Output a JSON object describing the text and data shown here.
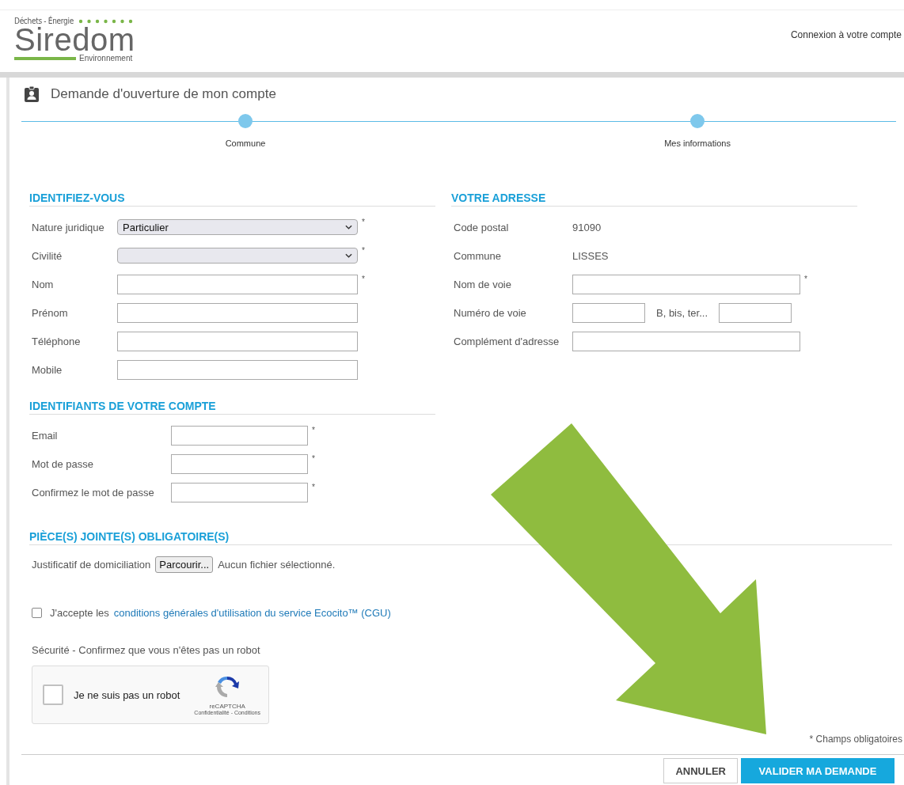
{
  "header": {
    "tagline": "Déchets - Énergie",
    "logo_name": "Siredom",
    "logo_subtitle": "Environnement",
    "login_link": "Connexion à votre compte"
  },
  "page_title": "Demande d'ouverture de mon compte",
  "steps": [
    {
      "label": "Commune"
    },
    {
      "label": "Mes informations"
    }
  ],
  "identity": {
    "title": "IDENTIFIEZ-VOUS",
    "fields": [
      {
        "kind": "select",
        "label": "Nature juridique",
        "value": "Particulier",
        "mark": "*"
      },
      {
        "kind": "select",
        "label": "Civilité",
        "mark": "*"
      },
      {
        "kind": "text",
        "label": "Nom",
        "mark": "*"
      },
      {
        "kind": "text",
        "label": "Prénom"
      },
      {
        "kind": "text",
        "label": "Téléphone"
      },
      {
        "kind": "text",
        "label": "Mobile"
      }
    ]
  },
  "address": {
    "title": "VOTRE ADRESSE",
    "fields": [
      {
        "kind": "static",
        "label": "Code postal",
        "value": "91090"
      },
      {
        "kind": "static",
        "label": "Commune",
        "value": "LISSES"
      },
      {
        "kind": "text",
        "label": "Nom de voie",
        "mark": "*"
      },
      {
        "kind": "pair",
        "label": "Numéro de voie",
        "second_label": "B, bis, ter..."
      },
      {
        "kind": "text",
        "label": "Complément d'adresse"
      }
    ]
  },
  "account": {
    "title": "IDENTIFIANTS DE VOTRE COMPTE",
    "fields": [
      {
        "kind": "text",
        "label": "Email",
        "mark": "*"
      },
      {
        "kind": "text",
        "label": "Mot de passe",
        "mark": "*"
      },
      {
        "kind": "text",
        "label": "Confirmez le mot de passe",
        "mark": "*"
      }
    ]
  },
  "attachments": {
    "title": "PIÈCE(S) JOINTE(S) OBLIGATOIRE(S)",
    "label": "Justificatif de domiciliation",
    "button": "Parcourir...",
    "status": "Aucun fichier sélectionné."
  },
  "terms": {
    "checked": false,
    "text": "J'accepte les",
    "link": "conditions générales d'utilisation du service Ecocito™ (CGU)"
  },
  "security": {
    "text": "Sécurité - Confirmez que vous n'êtes pas un robot",
    "captcha": {
      "checked": false,
      "label": "Je ne suis pas un robot",
      "brand": "reCAPTCHA",
      "links": "Confidentialité - Conditions"
    }
  },
  "required_note": "* Champs obligatoires",
  "buttons": [
    {
      "kind": "secondary",
      "label": "ANNULER"
    },
    {
      "kind": "primary",
      "label": "VALIDER MA DEMANDE"
    }
  ]
}
